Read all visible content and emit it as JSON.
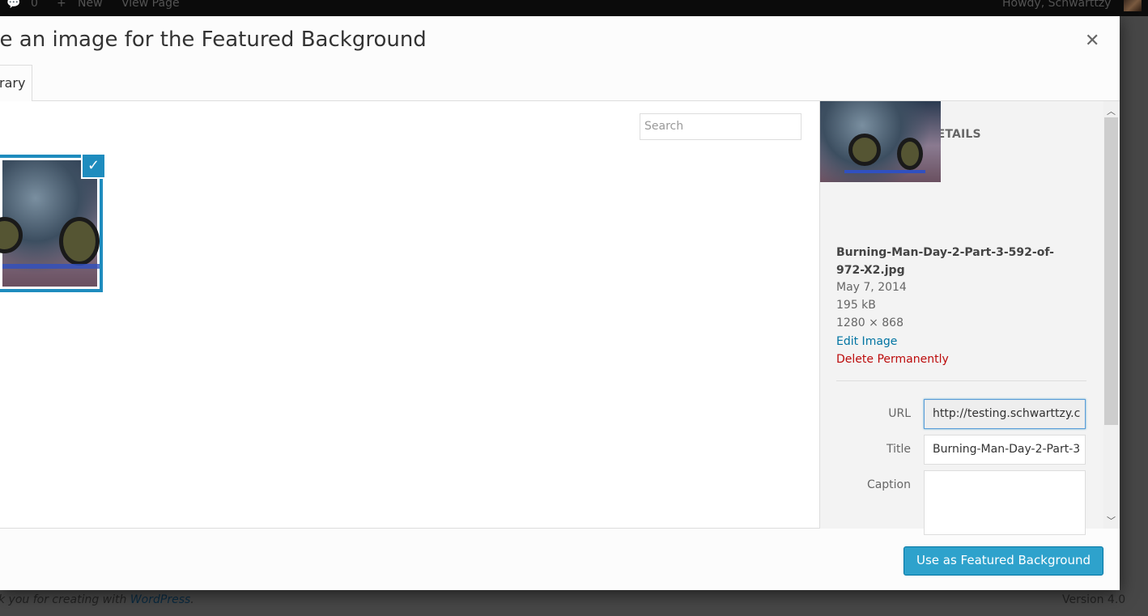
{
  "admin_bar": {
    "comments_count": "0",
    "new_label": "New",
    "view_page_label": "View Page",
    "greeting": "Howdy, Schwarttzy"
  },
  "footer": {
    "thanks_text": "k you for creating with ",
    "wordpress_link": "WordPress",
    "period": ".",
    "version": "Version 4.0"
  },
  "modal": {
    "title": "se an image for the Featured Background",
    "close_icon": "close-icon",
    "tab_label": "rary",
    "search_placeholder": "Search",
    "attachment": {
      "heading": "ATTACHMENT DETAILS",
      "filename": "Burning-Man-Day-2-Part-3-592-of-972-X2.jpg",
      "date": "May 7, 2014",
      "size": "195 kB",
      "dimensions": "1280 × 868",
      "edit_label": "Edit Image",
      "delete_label": "Delete Permanently",
      "fields": {
        "url_label": "URL",
        "url_value": "http://testing.schwarttzy.c",
        "title_label": "Title",
        "title_value": "Burning-Man-Day-2-Part-3",
        "caption_label": "Caption",
        "caption_value": ""
      }
    },
    "primary_button": "Use as Featured Background"
  },
  "colors": {
    "accent": "#2ea2cc",
    "selection": "#1e8cbe",
    "link": "#0074a2",
    "delete": "#bc0b0b"
  }
}
